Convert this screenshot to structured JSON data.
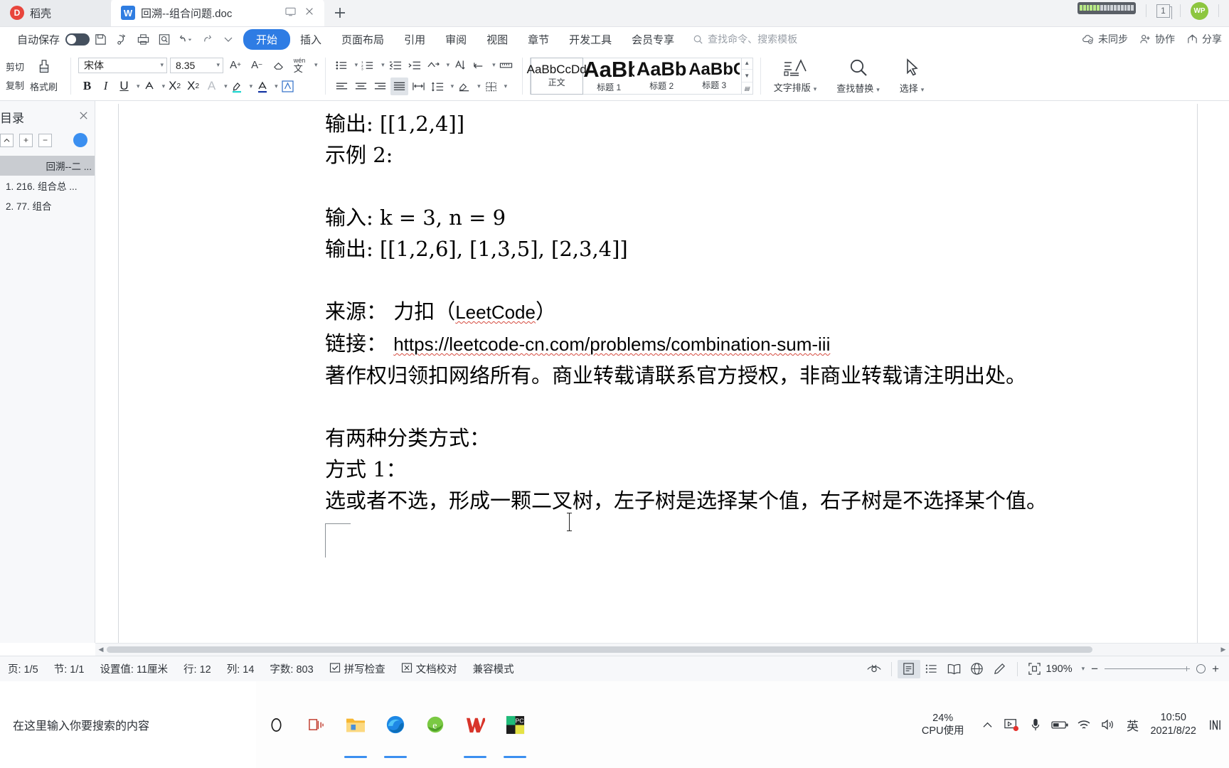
{
  "titlebar": {
    "cloud_tab": "稻壳",
    "cloud_icon": "dao-ke-icon",
    "doc_tab": "回溯--组合问题.doc",
    "doc_icon": "wps-writer-icon",
    "screen_icon": "monitor-icon",
    "close_icon": "close-icon",
    "newtab_icon": "plus-icon",
    "window_count": "1",
    "avatar_label": "WP"
  },
  "menubar": {
    "autosave_label": "自动保存",
    "quick_tools": [
      "save-icon",
      "save-as-icon",
      "print-icon",
      "print-preview-icon",
      "undo-icon",
      "redo-icon",
      "customize-qat-icon"
    ],
    "items": [
      {
        "label": "开始",
        "active": true
      },
      {
        "label": "插入",
        "active": false
      },
      {
        "label": "页面布局",
        "active": false
      },
      {
        "label": "引用",
        "active": false
      },
      {
        "label": "审阅",
        "active": false
      },
      {
        "label": "视图",
        "active": false
      },
      {
        "label": "章节",
        "active": false
      },
      {
        "label": "开发工具",
        "active": false
      },
      {
        "label": "会员专享",
        "active": false
      }
    ],
    "search_placeholder": "查找命令、搜索模板",
    "right_items": [
      {
        "label": "未同步",
        "icon": "cloud-sync-icon"
      },
      {
        "label": "协作",
        "icon": "collaborate-icon"
      },
      {
        "label": "分享",
        "icon": "share-icon"
      }
    ]
  },
  "ribbon": {
    "clipboard": {
      "cut": "剪切",
      "copy": "复制",
      "format_painter": "格式刷"
    },
    "font": {
      "family": "宋体",
      "size": "8.35",
      "grow_icon": "increase-font-size-icon",
      "shrink_icon": "decrease-font-size-icon",
      "clear_format_icon": "clear-formatting-icon",
      "pinyin_icon": "pinyin-guide-icon",
      "bold": "B",
      "italic": "I",
      "underline": "U",
      "strikethrough_icon": "strikethrough-icon",
      "superscript": "X²",
      "subscript": "X₂",
      "text_effects_icon": "text-effects-icon",
      "highlight_icon": "highlight-color-icon",
      "font_color_icon": "font-color-icon",
      "char_shading_icon": "character-shading-icon"
    },
    "paragraph": {
      "bullets_icon": "bullet-list-icon",
      "numbering_icon": "numbered-list-icon",
      "decrease_indent_icon": "decrease-indent-icon",
      "increase_indent_icon": "increase-indent-icon",
      "sort_icon": "sort-icon",
      "show_marks_icon": "show-paragraph-marks-icon",
      "align_left_icon": "align-left-icon",
      "align_center_icon": "align-center-icon",
      "align_right_icon": "align-right-icon",
      "justify_icon": "justify-icon",
      "distribute_icon": "distribute-icon",
      "line_spacing_icon": "line-spacing-icon",
      "shading_icon": "paragraph-shading-icon",
      "borders_icon": "borders-icon"
    },
    "styles": [
      {
        "sample": "AaBbCcDd",
        "name": "正文",
        "size": "17px",
        "weight": "400",
        "selected": true
      },
      {
        "sample": "AaBbC",
        "name": "标题 1",
        "size": "31px",
        "weight": "700",
        "selected": false
      },
      {
        "sample": "AaBb",
        "name": "标题 2",
        "size": "27px",
        "weight": "700",
        "selected": false
      },
      {
        "sample": "AaBbCc",
        "name": "标题 3",
        "size": "24px",
        "weight": "700",
        "selected": false
      }
    ],
    "text_layout": "文字排版",
    "find_replace": "查找替换",
    "select": "选择"
  },
  "navpane": {
    "title": "目录",
    "close_icon": "close-icon",
    "buttons": [
      "collapse-up-icon",
      "expand-plus-icon",
      "collapse-minus-icon"
    ],
    "items": [
      {
        "label": "回溯--二 ...",
        "selected": true
      },
      {
        "label": "1. 216. 组合总 ...",
        "selected": false
      },
      {
        "label": "2. 77. 组合",
        "selected": false
      }
    ]
  },
  "document": {
    "paragraphs": [
      {
        "text": "输出: [[1,2,4]]",
        "blank": false
      },
      {
        "text": "示例 2:",
        "blank": false
      },
      {
        "text": "",
        "blank": true
      },
      {
        "text": "输入: k = 3, n = 9",
        "blank": false
      },
      {
        "text": "输出: [[1,2,6], [1,3,5], [2,3,4]]",
        "blank": false
      },
      {
        "text": "",
        "blank": true
      },
      {
        "text": "来源： 力扣（LeetCode）",
        "blank": false
      },
      {
        "text": "链接： https://leetcode-cn.com/problems/combination-sum-iii",
        "blank": false
      },
      {
        "text": "著作权归领扣网络所有。商业转载请联系官方授权，非商业转载请注明出处。",
        "blank": false
      },
      {
        "text": "",
        "blank": true
      },
      {
        "text": "有两种分类方式：",
        "blank": false
      },
      {
        "text": "方式 1：",
        "blank": false
      },
      {
        "text": "选或者不选，形成一颗二叉树，左子树是选择某个值，右子树是不选择某个值。",
        "blank": false
      }
    ]
  },
  "statusbar": {
    "page": "页: 1/5",
    "section": "节: 1/1",
    "setting": "设置值: 11厘米",
    "row": "行: 12",
    "col": "列: 14",
    "words": "字数: 803",
    "spellcheck": "拼写检查",
    "spellcheck_icon": "spellcheck-icon",
    "proofread": "文档校对",
    "proofread_icon": "proofread-icon",
    "compat": "兼容模式",
    "eye_icon": "focus-mode-icon",
    "view_icons": [
      "page-view-icon",
      "outline-view-icon",
      "reading-view-icon",
      "web-view-icon",
      "ink-view-icon"
    ],
    "fit_icon": "fit-page-icon",
    "zoom": "190%",
    "zoom_out_icon": "zoom-out-icon",
    "zoom_in_icon": "zoom-in-icon"
  },
  "taskbar": {
    "search_placeholder": "在这里输入你要搜索的内容",
    "cortana_icon": "cortana-circle-icon",
    "taskview_icon": "task-view-icon",
    "apps": [
      {
        "name": "file-explorer-icon",
        "running": true
      },
      {
        "name": "microsoft-edge-icon",
        "running": true
      },
      {
        "name": "internet-explorer-icon",
        "running": false
      },
      {
        "name": "wps-office-icon",
        "running": true
      },
      {
        "name": "pycharm-icon",
        "running": true
      }
    ],
    "cpu_percent": "24%",
    "cpu_label": "CPU使用",
    "tray": [
      "chevron-up-icon",
      "screen-recorder-icon",
      "microphone-icon",
      "battery-icon",
      "wifi-icon",
      "volume-icon"
    ],
    "ime": "英",
    "time": "10:50",
    "date": "2021/8/22",
    "notification_icon": "notification-icon"
  },
  "colors": {
    "accent": "#2e7ce4",
    "titlebar_bg": "#f2f3f5",
    "spell_error": "#d64b3f",
    "avatar_green": "#8dc63f"
  }
}
